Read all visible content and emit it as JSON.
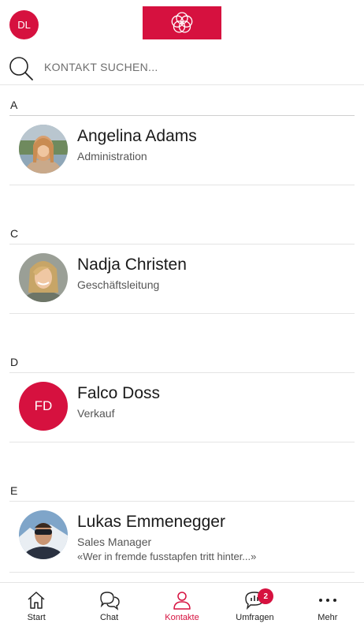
{
  "header": {
    "user_initials": "DL"
  },
  "search": {
    "placeholder": "KONTAKT SUCHEN..."
  },
  "sections": [
    {
      "letter": "A",
      "contacts": [
        {
          "name": "Angelina Adams",
          "role": "Administration",
          "status": "",
          "avatar": "photo-woman-blonde-outdoor"
        }
      ]
    },
    {
      "letter": "C",
      "contacts": [
        {
          "name": "Nadja Christen",
          "role": "Geschäftsleitung",
          "status": "",
          "avatar": "photo-woman-smiling"
        }
      ]
    },
    {
      "letter": "D",
      "contacts": [
        {
          "name": "Falco Doss",
          "role": "Verkauf",
          "status": "",
          "initials": "FD"
        }
      ]
    },
    {
      "letter": "E",
      "contacts": [
        {
          "name": "Lukas Emmenegger",
          "role": "Sales Manager",
          "status": "«Wer in fremde fusstapfen tritt hinter...»",
          "avatar": "photo-man-sunglasses-mountains"
        }
      ]
    }
  ],
  "nav": {
    "items": [
      {
        "label": "Start",
        "icon": "home-icon"
      },
      {
        "label": "Chat",
        "icon": "chat-icon"
      },
      {
        "label": "Kontakte",
        "icon": "contacts-icon",
        "active": true
      },
      {
        "label": "Umfragen",
        "icon": "survey-icon",
        "badge": "2"
      },
      {
        "label": "Mehr",
        "icon": "more-icon"
      }
    ]
  },
  "colors": {
    "accent": "#d6113f"
  }
}
